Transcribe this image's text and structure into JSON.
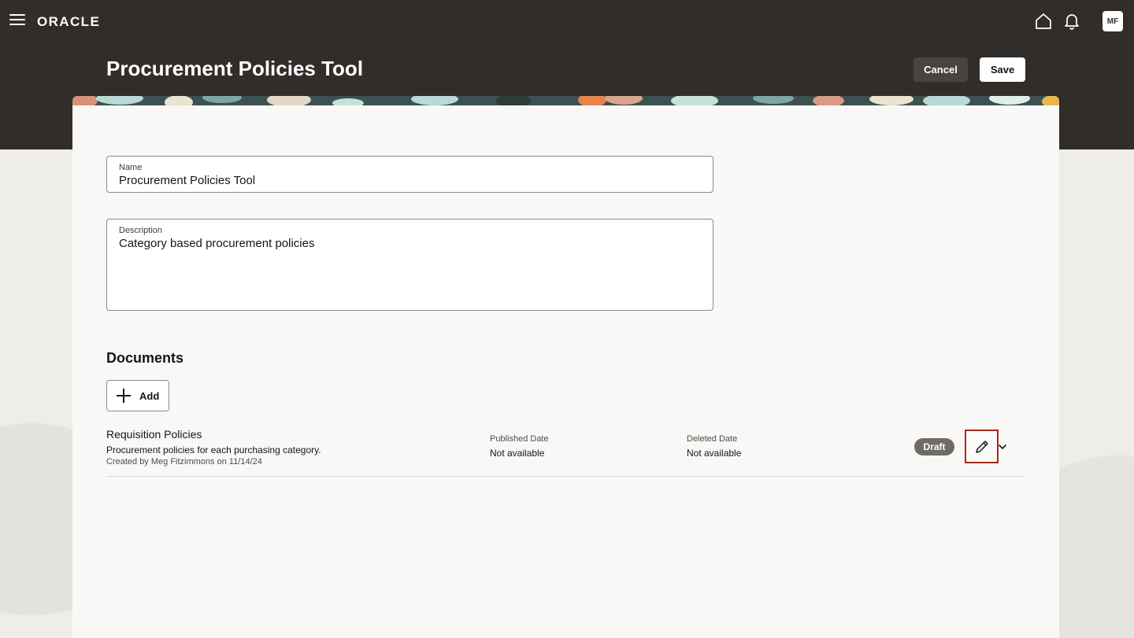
{
  "header": {
    "brand": "ORACLE",
    "avatar_initials": "MF",
    "icons": [
      "menu-icon",
      "home-icon",
      "bell-icon"
    ]
  },
  "page": {
    "title": "Procurement Policies Tool",
    "cancel_label": "Cancel",
    "save_label": "Save"
  },
  "form": {
    "name_label": "Name",
    "name_value": "Procurement Policies Tool",
    "description_label": "Description",
    "description_value": "Category based procurement policies"
  },
  "documents": {
    "title": "Documents",
    "add_label": "Add",
    "rows": [
      {
        "name": "Requisition Policies",
        "description": "Procurement policies for each purchasing category.",
        "created": "Created by Meg Fitzimmons on 11/14/24",
        "published_label": "Published Date",
        "published_value": "Not available",
        "deleted_label": "Deleted Date",
        "deleted_value": "Not available",
        "status": "Draft"
      }
    ]
  },
  "colors": {
    "header_bg": "#312d2a",
    "card_bg": "#f9f8f6",
    "badge_bg": "#6f6b66",
    "highlight": "#a5291f"
  }
}
